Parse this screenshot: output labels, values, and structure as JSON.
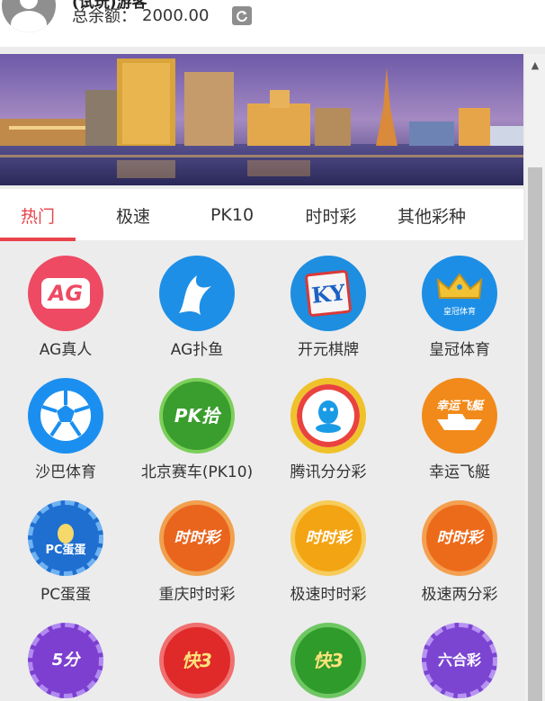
{
  "header": {
    "username": "(试玩)游客",
    "balance_label": "总余额：",
    "balance_value": "2000.00",
    "refresh_icon": "refresh-icon"
  },
  "tabs": [
    {
      "label": "热门",
      "active": true
    },
    {
      "label": "极速",
      "active": false
    },
    {
      "label": "PK10",
      "active": false
    },
    {
      "label": "时时彩",
      "active": false
    },
    {
      "label": "其他彩种",
      "active": false
    }
  ],
  "games": [
    {
      "label": "AG真人",
      "icon": "ag-live-icon",
      "badge": "AG",
      "color": "#ee4a63"
    },
    {
      "label": "AG扑鱼",
      "icon": "ag-fish-icon",
      "badge": "",
      "color": "#1e8fe6"
    },
    {
      "label": "开元棋牌",
      "icon": "ky-chess-icon",
      "badge": "KY",
      "color": "#1d8ee0"
    },
    {
      "label": "皇冠体育",
      "icon": "crown-sports-icon",
      "badge": "皇冠体育",
      "color": "#1c8ee6"
    },
    {
      "label": "沙巴体育",
      "icon": "soccer-ball-icon",
      "badge": "",
      "color": "#1b8ff0"
    },
    {
      "label": "北京赛车(PK10)",
      "icon": "pk10-icon",
      "badge": "PK拾",
      "color": "#3a9e2e"
    },
    {
      "label": "腾讯分分彩",
      "icon": "tencent-icon",
      "badge": "",
      "color": "#ffffff"
    },
    {
      "label": "幸运飞艇",
      "icon": "lucky-boat-icon",
      "badge": "幸运飞艇",
      "color": "#f18a1a"
    },
    {
      "label": "PC蛋蛋",
      "icon": "pc-egg-icon",
      "badge": "PC蛋蛋",
      "color": "#1e6fd0"
    },
    {
      "label": "重庆时时彩",
      "icon": "cq-ssc-icon",
      "badge": "时时彩",
      "color": "#e9641d"
    },
    {
      "label": "极速时时彩",
      "icon": "fast-ssc-icon",
      "badge": "时时彩",
      "color": "#f3a413"
    },
    {
      "label": "极速两分彩",
      "icon": "fast-2min-icon",
      "badge": "时时彩",
      "color": "#ec6b1b"
    },
    {
      "label": "",
      "icon": "5min-ssc-icon",
      "badge": "5分",
      "color": "#7d3fd0"
    },
    {
      "label": "",
      "icon": "kuai3-icon",
      "badge": "快3",
      "color": "#e02929"
    },
    {
      "label": "",
      "icon": "jiangsu-k3-icon",
      "badge": "快3",
      "color": "#2f9b2a"
    },
    {
      "label": "",
      "icon": "mark-six-icon",
      "badge": "六合彩",
      "color": "#7b45d2"
    }
  ]
}
